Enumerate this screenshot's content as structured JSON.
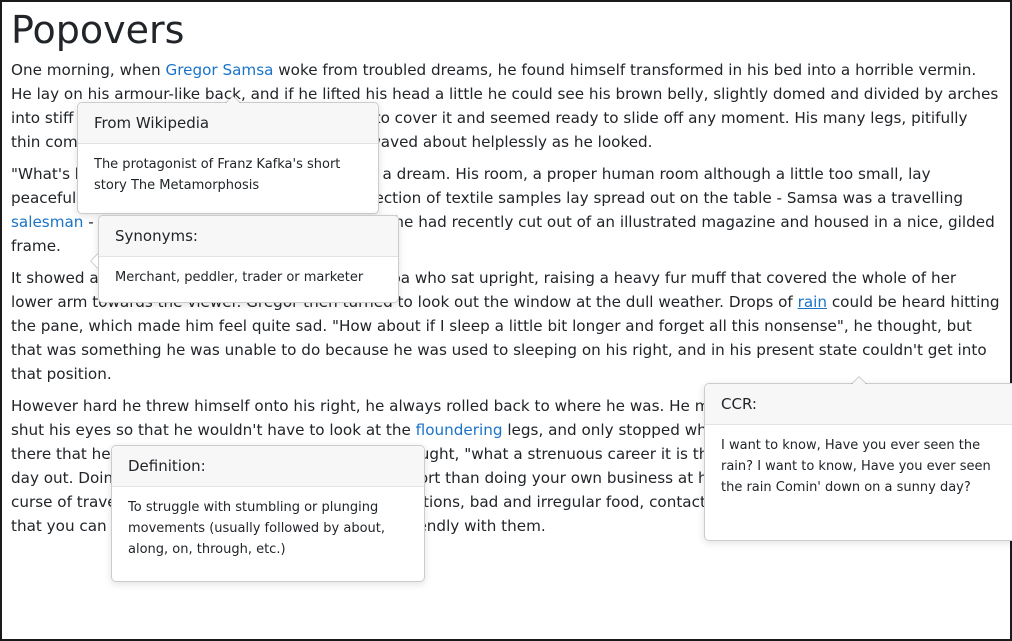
{
  "page": {
    "title": "Popovers"
  },
  "paragraphs": {
    "p1": {
      "before": "One morning, when ",
      "link": "Gregor Samsa",
      "after": " woke from troubled dreams, he found himself transformed in his bed into a horrible vermin. He lay on his armour-like back, and if he lifted his head a little he could see his brown belly, slightly domed and divided by arches into stiff sections. The bedding was hardly able to cover it and seemed ready to slide off any moment. His many legs, pitifully thin compared with the size of the rest of him, waved about helplessly as he looked."
    },
    "p2": {
      "before": "\"What's happened to me?\" he thought. It wasn't a dream. His room, a proper human room although a little too small, lay peacefully between its four familiar walls. A collection of textile samples lay spread out on the table - Samsa was a travelling ",
      "link": "salesman",
      "after": " - and above it there hung a picture that he had recently cut out of an illustrated magazine and housed in a nice, gilded frame."
    },
    "p3": {
      "before": "It showed a lady fitted out with a fur hat and fur boa who sat upright, raising a heavy fur muff that covered the whole of her lower arm towards the viewer. Gregor then turned to look out the window at the dull weather. Drops of ",
      "link": "rain",
      "after": " could be heard hitting the pane, which made him feel quite sad. \"How about if I sleep a little bit longer and forget all this nonsense\", he thought, but that was something he was unable to do because he was used to sleeping on his right, and in his present state couldn't get into that position."
    },
    "p4": {
      "before": "However hard he threw himself onto his right, he always rolled back to where he was. He must have tried it a hundred times, shut his eyes so that he wouldn't have to look at the ",
      "link": "floundering",
      "after": " legs, and only stopped when he began to feel a mild, dull pain there that he had never felt before. \"Oh, God\", he thought, \"what a strenuous career it is that I've chosen! Travelling day in and day out. Doing business like this takes much more effort than doing your own business at home, and on top of that there's the curse of travelling, worries about making train connections, bad and irregular food, contact with different people all the time so that you can never get to know anyone or become friendly with them."
    }
  },
  "popovers": {
    "wikipedia": {
      "title": "From Wikipedia",
      "body": "The protagonist of Franz Kafka's short story The Metamorphosis"
    },
    "synonyms": {
      "title": "Synonyms:",
      "body": "Merchant, peddler, trader or marketer"
    },
    "ccr": {
      "title": "CCR:",
      "body": "I want to know, Have you ever seen the rain? I want to know, Have you ever seen the rain Comin' down on a sunny day?"
    },
    "definition": {
      "title": "Definition:",
      "body": "To struggle with stumbling or plunging movements (usually followed by about, along, on, through, etc.)"
    }
  },
  "colors": {
    "link": "#1a73c8",
    "text": "#212529",
    "popover_header_bg": "#f7f7f7"
  }
}
